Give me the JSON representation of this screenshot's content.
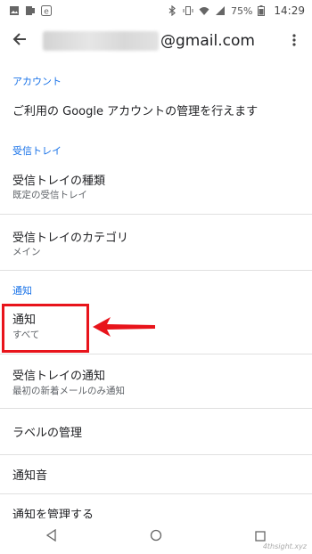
{
  "status_bar": {
    "battery_percent": "75%",
    "time": "14:29",
    "left_icons": [
      "image-icon",
      "mirror-icon",
      "e-app-icon"
    ],
    "right_icons": [
      "bluetooth-icon",
      "vibrate-icon",
      "wifi-icon",
      "signal-icon",
      "battery-icon"
    ]
  },
  "appbar": {
    "account_suffix": "@gmail.com"
  },
  "sections": {
    "account_header": "アカウント",
    "account_manage": "ご利用の Google アカウントの管理を行えます",
    "inbox_header": "受信トレイ",
    "inbox_type_title": "受信トレイの種類",
    "inbox_type_sub": "既定の受信トレイ",
    "inbox_category_title": "受信トレイのカテゴリ",
    "inbox_category_sub": "メイン",
    "notif_header": "通知",
    "notif_title": "通知",
    "notif_sub": "すべて",
    "inbox_notif_title": "受信トレイの通知",
    "inbox_notif_sub": "最初の新着メールのみ通知",
    "label_manage": "ラベルの管理",
    "notif_sound": "通知音",
    "notif_manage": "通知を管理する"
  },
  "watermark": "4thsight.xyz",
  "colors": {
    "accent": "#1a73e8",
    "highlight": "#e8141b"
  }
}
